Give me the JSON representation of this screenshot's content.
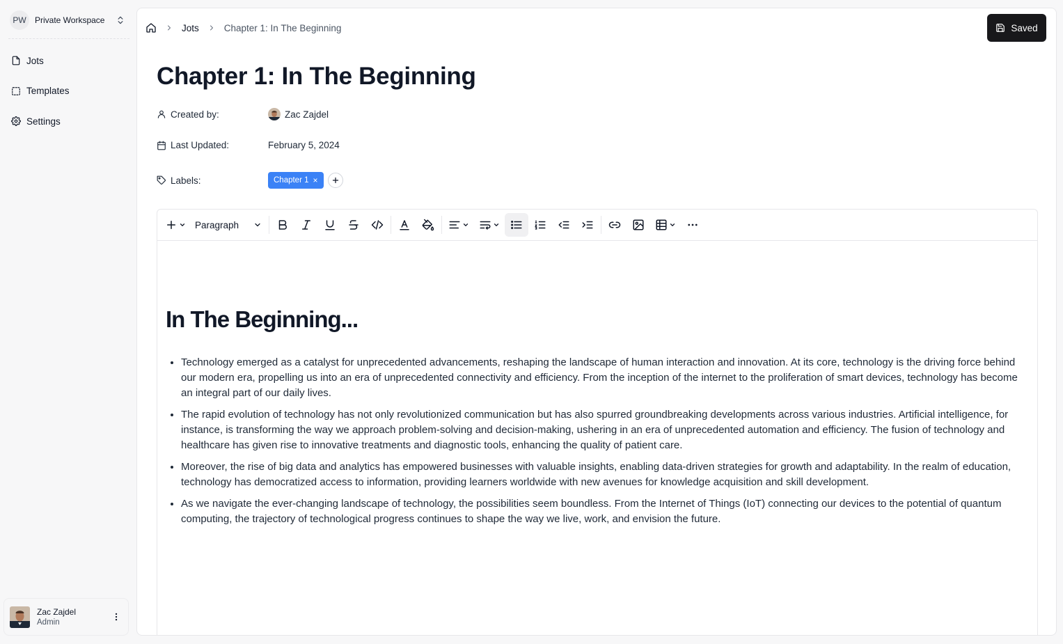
{
  "workspace": {
    "initials": "PW",
    "name": "Private Workspace"
  },
  "sidebar": {
    "items": [
      {
        "label": "Jots",
        "icon": "file-icon"
      },
      {
        "label": "Templates",
        "icon": "template-icon"
      },
      {
        "label": "Settings",
        "icon": "gear-icon"
      }
    ]
  },
  "user": {
    "name": "Zac Zajdel",
    "role": "Admin"
  },
  "breadcrumb": {
    "parent": "Jots",
    "current": "Chapter 1: In The Beginning"
  },
  "header": {
    "save_label": "Saved"
  },
  "document": {
    "title": "Chapter 1: In The Beginning",
    "created_by_label": "Created by:",
    "creator": "Zac Zajdel",
    "updated_label": "Last Updated:",
    "updated_value": "February 5, 2024",
    "labels_label": "Labels:",
    "labels": [
      "Chapter 1"
    ]
  },
  "toolbar": {
    "block_type": "Paragraph"
  },
  "content": {
    "heading": "In The Beginning...",
    "bullets": [
      "Technology emerged as a catalyst for unprecedented advancements, reshaping the landscape of human interaction and innovation. At its core, technology is the driving force behind our modern era, propelling us into an era of unprecedented connectivity and efficiency. From the inception of the internet to the proliferation of smart devices, technology has become an integral part of our daily lives.",
      "The rapid evolution of technology has not only revolutionized communication but has also spurred groundbreaking developments across various industries. Artificial intelligence, for instance, is transforming the way we approach problem-solving and decision-making, ushering in an era of unprecedented automation and efficiency. The fusion of technology and healthcare has given rise to innovative treatments and diagnostic tools, enhancing the quality of patient care.",
      "Moreover, the rise of big data and analytics has empowered businesses with valuable insights, enabling data-driven strategies for growth and adaptability. In the realm of education, technology has democratized access to information, providing learners worldwide with new avenues for knowledge acquisition and skill development.",
      "As we navigate the ever-changing landscape of technology, the possibilities seem boundless. From the Internet of Things (IoT) connecting our devices to the potential of quantum computing, the trajectory of technological progress continues to shape the way we live, work, and envision the future."
    ]
  },
  "colors": {
    "accent": "#3b82f6",
    "button_dark": "#18181b",
    "background": "#f7f7f8"
  }
}
